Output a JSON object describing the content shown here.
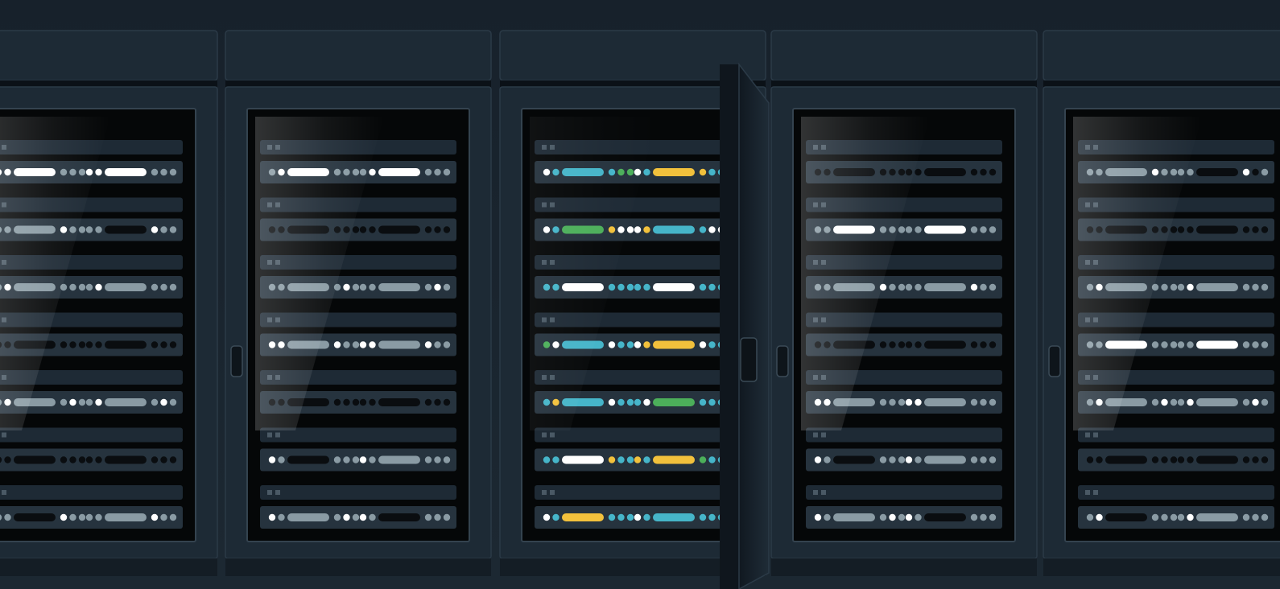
{
  "scene": {
    "colors": {
      "background": "#1b2631",
      "cabinet": "#1d2a35",
      "cabinet_edge": "#2b3a47",
      "screen": "#050708",
      "slot_dark": "#1e2a35",
      "accent_blue": "#46b5c9",
      "accent_yellow": "#f2c13c",
      "accent_green": "#4caf5a",
      "light_white": "#ffffff",
      "light_gray": "#8a9ba4",
      "light_black": "#0a0d10"
    },
    "cabinets": [
      {
        "id": "rack-1",
        "theme": "mono",
        "handle": true,
        "rows": [
          {
            "g1": [
              "W",
              "W",
              "G",
              "G",
              "G"
            ],
            "g2": [
              "W",
              "W",
              "G",
              "G",
              "G"
            ],
            "b1": "W",
            "b2": "W"
          },
          {
            "g1": [
              "G",
              "G",
              "W",
              "G",
              "G"
            ],
            "g2": [
              "G",
              "G",
              "W",
              "G",
              "G"
            ],
            "b1": "G",
            "b2": "K"
          },
          {
            "g1": [
              "G",
              "W",
              "G",
              "G",
              "G"
            ],
            "g2": [
              "G",
              "W",
              "G",
              "G",
              "G"
            ],
            "b1": "G",
            "b2": "G"
          },
          {
            "g1": [
              "K",
              "K",
              "K",
              "K",
              "K"
            ],
            "g2": [
              "K",
              "K",
              "K",
              "K",
              "K"
            ],
            "b1": "K",
            "b2": "K"
          },
          {
            "g1": [
              "G",
              "W",
              "G",
              "W",
              "G"
            ],
            "g2": [
              "G",
              "W",
              "G",
              "W",
              "G"
            ],
            "b1": "G",
            "b2": "G"
          },
          {
            "g1": [
              "K",
              "K",
              "K",
              "K",
              "K"
            ],
            "g2": [
              "K",
              "K",
              "K",
              "K",
              "K"
            ],
            "b1": "K",
            "b2": "K"
          },
          {
            "g1": [
              "G",
              "G",
              "W",
              "G",
              "G"
            ],
            "g2": [
              "G",
              "G",
              "W",
              "G",
              "G"
            ],
            "b1": "K",
            "b2": "G"
          }
        ]
      },
      {
        "id": "rack-2",
        "theme": "mono",
        "handle": true,
        "rows": [
          {
            "g1": [
              "G",
              "W",
              "G",
              "G",
              "G"
            ],
            "g2": [
              "G",
              "W",
              "G",
              "G",
              "G"
            ],
            "b1": "W",
            "b2": "W"
          },
          {
            "g1": [
              "K",
              "K",
              "K",
              "K",
              "K"
            ],
            "g2": [
              "K",
              "K",
              "K",
              "K",
              "K"
            ],
            "b1": "K",
            "b2": "K"
          },
          {
            "g1": [
              "G",
              "G",
              "G",
              "W",
              "G"
            ],
            "g2": [
              "G",
              "G",
              "G",
              "W",
              "G"
            ],
            "b1": "G",
            "b2": "G"
          },
          {
            "g1": [
              "W",
              "W",
              "W",
              "G",
              "G"
            ],
            "g2": [
              "W",
              "W",
              "W",
              "G",
              "G"
            ],
            "b1": "G",
            "b2": "G"
          },
          {
            "g1": [
              "K",
              "K",
              "K",
              "K",
              "K"
            ],
            "g2": [
              "K",
              "K",
              "K",
              "K",
              "K"
            ],
            "b1": "K",
            "b2": "K"
          },
          {
            "g1": [
              "W",
              "G",
              "G",
              "G",
              "G"
            ],
            "g2": [
              "W",
              "G",
              "G",
              "G",
              "G"
            ],
            "b1": "K",
            "b2": "G"
          },
          {
            "g1": [
              "W",
              "G",
              "G",
              "W",
              "G"
            ],
            "g2": [
              "W",
              "G",
              "G",
              "G",
              "G"
            ],
            "b1": "G",
            "b2": "K"
          }
        ]
      },
      {
        "id": "rack-3",
        "theme": "color",
        "handle": false,
        "rows": [
          {
            "g1": [
              "W",
              "B",
              "B",
              "L",
              "L"
            ],
            "g2": [
              "W",
              "B",
              "Y",
              "B",
              "B"
            ],
            "b1": "B",
            "b2": "Y"
          },
          {
            "g1": [
              "W",
              "B",
              "Y",
              "W",
              "W"
            ],
            "g2": [
              "W",
              "Y",
              "B",
              "W",
              "W"
            ],
            "b1": "L",
            "b2": "B"
          },
          {
            "g1": [
              "B",
              "B",
              "B",
              "B",
              "B"
            ],
            "g2": [
              "B",
              "B",
              "B",
              "B",
              "B"
            ],
            "b1": "W",
            "b2": "W"
          },
          {
            "g1": [
              "L",
              "W",
              "W",
              "B",
              "B"
            ],
            "g2": [
              "W",
              "Y",
              "W",
              "B",
              "B"
            ],
            "b1": "B",
            "b2": "Y"
          },
          {
            "g1": [
              "B",
              "Y",
              "W",
              "B",
              "B"
            ],
            "g2": [
              "B",
              "W",
              "B",
              "B",
              "B"
            ],
            "b1": "B",
            "b2": "L"
          },
          {
            "g1": [
              "B",
              "B",
              "Y",
              "B",
              "B"
            ],
            "g2": [
              "Y",
              "B",
              "L",
              "B",
              "B"
            ],
            "b1": "W",
            "b2": "Y"
          },
          {
            "g1": [
              "W",
              "B",
              "B",
              "B",
              "B"
            ],
            "g2": [
              "W",
              "B",
              "B",
              "B",
              "B"
            ],
            "b1": "Y",
            "b2": "B"
          }
        ]
      },
      {
        "id": "rack-4",
        "theme": "mono",
        "handle": true,
        "rows": [
          {
            "g1": [
              "K",
              "K",
              "K",
              "K",
              "K"
            ],
            "g2": [
              "K",
              "K",
              "K",
              "K",
              "K"
            ],
            "b1": "K",
            "b2": "K"
          },
          {
            "g1": [
              "G",
              "G",
              "G",
              "G",
              "G"
            ],
            "g2": [
              "G",
              "G",
              "G",
              "G",
              "G"
            ],
            "b1": "W",
            "b2": "W"
          },
          {
            "g1": [
              "G",
              "G",
              "W",
              "G",
              "G"
            ],
            "g2": [
              "G",
              "G",
              "W",
              "G",
              "G"
            ],
            "b1": "G",
            "b2": "G"
          },
          {
            "g1": [
              "K",
              "K",
              "K",
              "K",
              "K"
            ],
            "g2": [
              "K",
              "K",
              "K",
              "K",
              "K"
            ],
            "b1": "K",
            "b2": "K"
          },
          {
            "g1": [
              "W",
              "W",
              "G",
              "G",
              "G"
            ],
            "g2": [
              "W",
              "W",
              "G",
              "G",
              "G"
            ],
            "b1": "G",
            "b2": "G"
          },
          {
            "g1": [
              "W",
              "G",
              "G",
              "G",
              "G"
            ],
            "g2": [
              "W",
              "G",
              "G",
              "G",
              "G"
            ],
            "b1": "K",
            "b2": "G"
          },
          {
            "g1": [
              "W",
              "G",
              "G",
              "W",
              "G"
            ],
            "g2": [
              "W",
              "G",
              "G",
              "G",
              "G"
            ],
            "b1": "G",
            "b2": "K"
          }
        ]
      },
      {
        "id": "rack-5",
        "theme": "mono",
        "handle": true,
        "rows": [
          {
            "g1": [
              "G",
              "G",
              "W",
              "G",
              "G"
            ],
            "g2": [
              "G",
              "G",
              "W",
              "K",
              "G"
            ],
            "b1": "G",
            "b2": "K"
          },
          {
            "g1": [
              "K",
              "K",
              "K",
              "K",
              "K"
            ],
            "g2": [
              "K",
              "K",
              "K",
              "K",
              "K"
            ],
            "b1": "K",
            "b2": "K"
          },
          {
            "g1": [
              "G",
              "W",
              "G",
              "G",
              "G"
            ],
            "g2": [
              "G",
              "W",
              "G",
              "G",
              "G"
            ],
            "b1": "G",
            "b2": "G"
          },
          {
            "g1": [
              "G",
              "G",
              "G",
              "G",
              "G"
            ],
            "g2": [
              "G",
              "G",
              "G",
              "G",
              "G"
            ],
            "b1": "W",
            "b2": "W"
          },
          {
            "g1": [
              "G",
              "W",
              "G",
              "W",
              "G"
            ],
            "g2": [
              "G",
              "W",
              "G",
              "W",
              "G"
            ],
            "b1": "G",
            "b2": "G"
          },
          {
            "g1": [
              "K",
              "K",
              "K",
              "K",
              "K"
            ],
            "g2": [
              "K",
              "K",
              "K",
              "K",
              "K"
            ],
            "b1": "K",
            "b2": "K"
          },
          {
            "g1": [
              "G",
              "W",
              "G",
              "G",
              "G"
            ],
            "g2": [
              "G",
              "W",
              "G",
              "G",
              "G"
            ],
            "b1": "K",
            "b2": "G"
          }
        ]
      }
    ]
  }
}
